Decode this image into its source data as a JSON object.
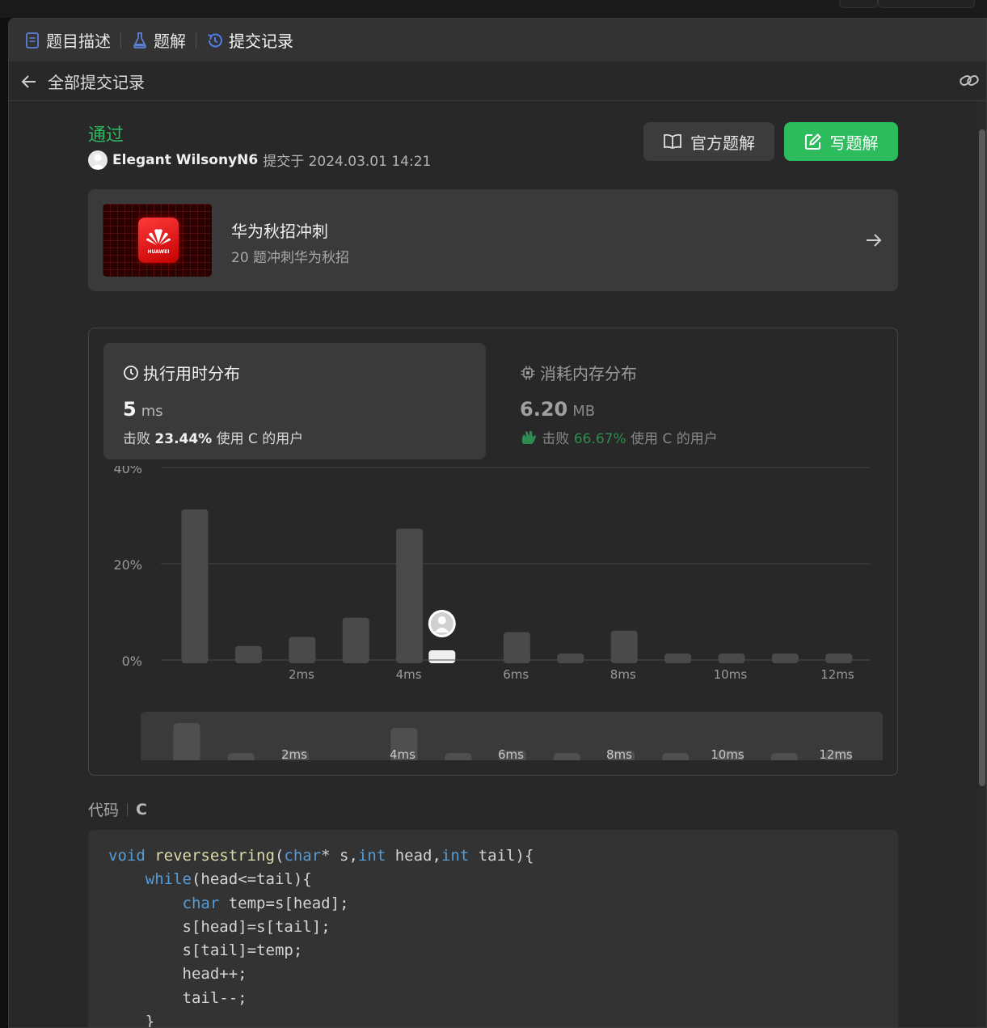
{
  "tabs": [
    {
      "label": "题目描述",
      "icon": "document-icon"
    },
    {
      "label": "题解",
      "icon": "flask-icon"
    },
    {
      "label": "提交记录",
      "icon": "history-icon"
    }
  ],
  "subheader": {
    "back_label": "全部提交记录"
  },
  "submission": {
    "status": "通过",
    "username": "Elegant WilsonyN6",
    "submitted_text": "提交于 2024.03.01 14:21",
    "official_solution_label": "官方题解",
    "write_solution_label": "写题解"
  },
  "promo": {
    "title": "华为秋招冲刺",
    "subtitle": "20 题冲刺华为秋招",
    "logo_text": "HUAWEI"
  },
  "runtime": {
    "title": "执行用时分布",
    "value": "5",
    "unit": "ms",
    "beat_prefix": "击败",
    "beat_pct": "23.44%",
    "beat_suffix": "使用 C 的用户"
  },
  "memory": {
    "title": "消耗内存分布",
    "value": "6.20",
    "unit": "MB",
    "beat_prefix": "击败",
    "beat_pct": "66.67%",
    "beat_suffix": "使用 C 的用户"
  },
  "chart_data": {
    "type": "bar",
    "title": "执行用时分布",
    "xlabel": "",
    "ylabel": "",
    "ylim": [
      0,
      40
    ],
    "ytick_labels": [
      "0%",
      "20%",
      "40%"
    ],
    "yticks": [
      0,
      20,
      40
    ],
    "xtick_labels": [
      "2ms",
      "4ms",
      "6ms",
      "8ms",
      "10ms",
      "12ms"
    ],
    "categories": [
      "1ms",
      "2ms",
      "3ms",
      "4ms",
      "5ms",
      "6ms",
      "7ms",
      "8ms",
      "9ms",
      "10ms",
      "11ms",
      "12ms",
      "13ms"
    ],
    "values": [
      31.3,
      2.9,
      4.8,
      8.8,
      27.3,
      1.8,
      5.8,
      1.1,
      6.1,
      1.1,
      1.1,
      1.1,
      1.1
    ],
    "highlight_index": 5,
    "highlight_label": "5 ms",
    "colors": {
      "bar": "#4a4a4a",
      "highlight": "#f0f0f0",
      "grid": "#454545"
    }
  },
  "mini_chart": {
    "xtick_labels": [
      "2ms",
      "4ms",
      "6ms",
      "8ms",
      "10ms",
      "12ms"
    ]
  },
  "code": {
    "label": "代码",
    "language": "C",
    "lines": [
      "void reversestring(char* s,int head,int tail){",
      "    while(head<=tail){",
      "        char temp=s[head];",
      "        s[head]=s[tail];",
      "        s[tail]=temp;",
      "        head++;",
      "        tail--;",
      "    }"
    ]
  },
  "colors": {
    "accent_green": "#2cbb5d",
    "background": "#282828",
    "card": "#3a3a3a"
  }
}
